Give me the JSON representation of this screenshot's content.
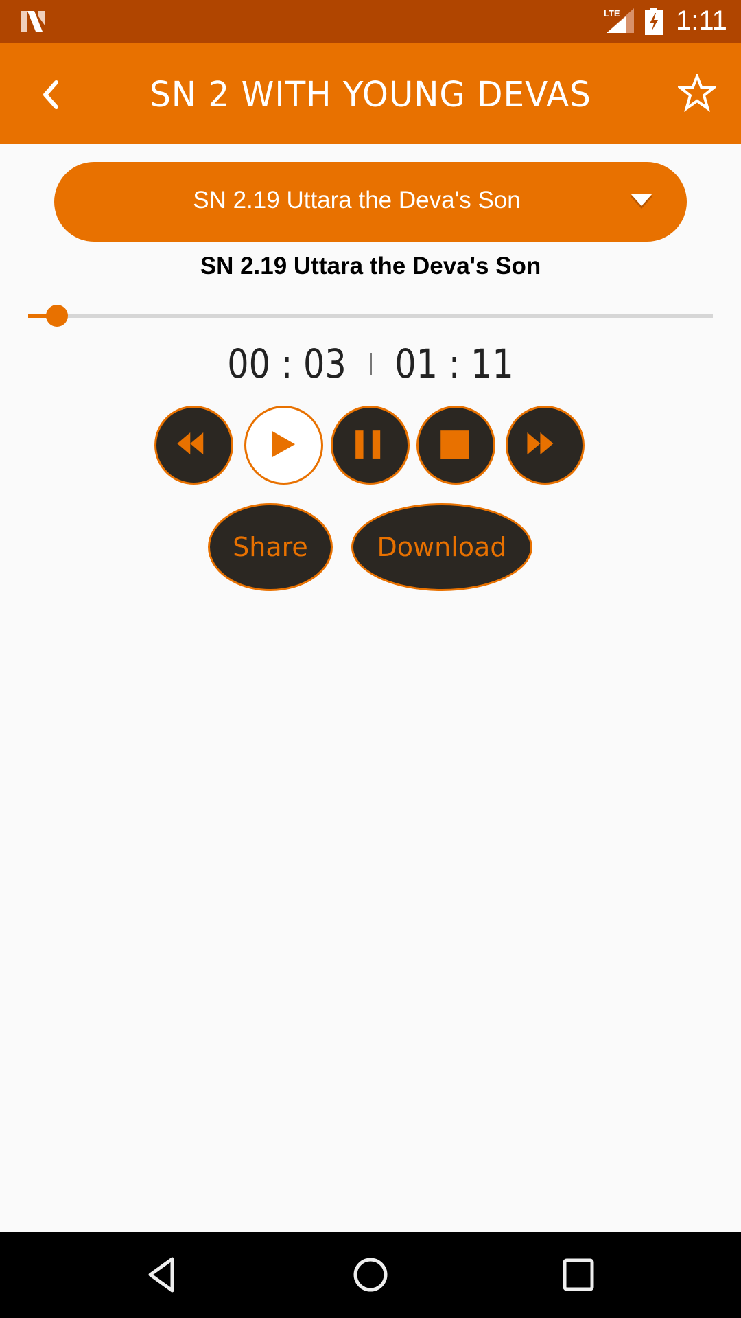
{
  "status_bar": {
    "network": "LTE",
    "time": "1:11"
  },
  "app_bar": {
    "title": "SN 2 WITH YOUNG DEVAS",
    "back_icon": "chevron-left-icon",
    "favorite_icon": "star-outline-icon"
  },
  "track_selector": {
    "selected": "SN 2.19 Uttara the Deva's Son",
    "icon": "triangle-down-icon"
  },
  "player": {
    "track_title": "SN 2.19 Uttara the Deva's Son",
    "elapsed": "00 : 03",
    "duration": "01 : 11",
    "progress_fraction": 0.042,
    "controls": [
      {
        "name": "rewind",
        "icon": "rewind-icon"
      },
      {
        "name": "play",
        "icon": "play-icon"
      },
      {
        "name": "pause",
        "icon": "pause-icon"
      },
      {
        "name": "stop",
        "icon": "stop-icon"
      },
      {
        "name": "fast-forward",
        "icon": "fast-forward-icon"
      }
    ]
  },
  "actions": {
    "share_label": "Share",
    "download_label": "Download"
  },
  "nav_bar": {
    "back": "nav-back-icon",
    "home": "nav-home-icon",
    "recents": "nav-recents-icon"
  },
  "colors": {
    "accent": "#e87100",
    "status_bar": "#b04500",
    "button_dark": "#2b2722"
  }
}
